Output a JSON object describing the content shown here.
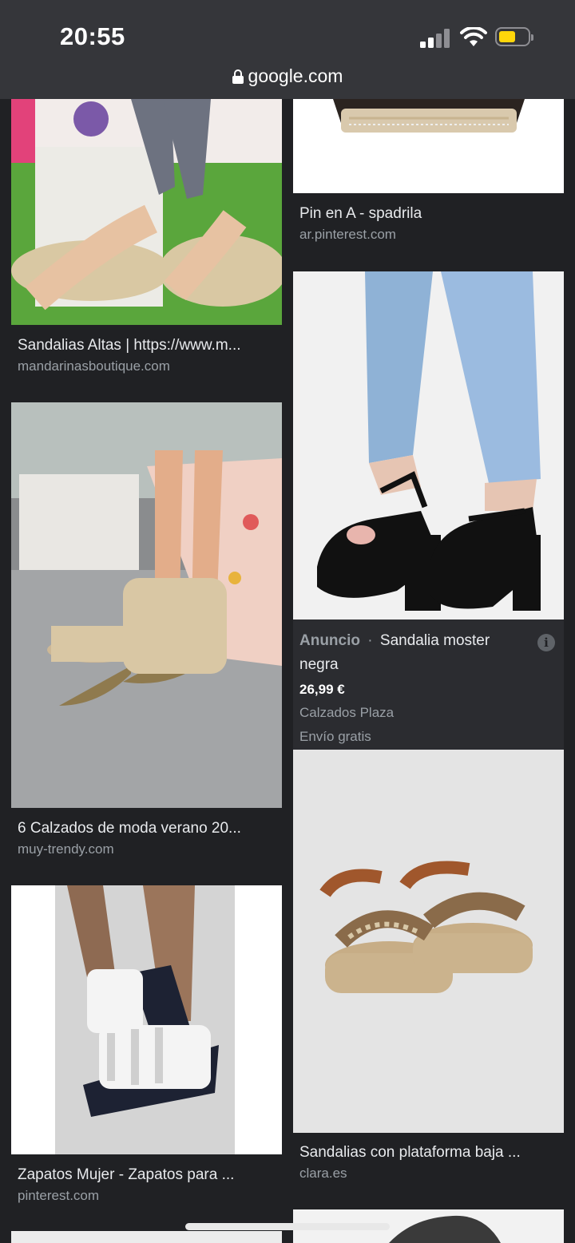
{
  "status_bar": {
    "time": "20:55"
  },
  "browser": {
    "url": "google.com"
  },
  "results": {
    "left": [
      {
        "title": "Sandalias Altas | https://www.m...",
        "source": "mandarinasboutique.com"
      },
      {
        "title": "6 Calzados de moda verano 20...",
        "source": "muy-trendy.com"
      },
      {
        "title": "Zapatos Mujer - Zapatos para ...",
        "source": "pinterest.com"
      }
    ],
    "right": [
      {
        "title": "Pin en A - spadrila",
        "source": "ar.pinterest.com"
      },
      {
        "ad_label": "Anuncio",
        "separator": "·",
        "title_line1": "Sandalia moster",
        "title_line2": "negra",
        "price": "26,99 €",
        "merchant": "Calzados Plaza",
        "shipping": "Envío gratis",
        "info_icon": "i"
      },
      {
        "title": "Sandalias con plataforma baja ...",
        "source": "clara.es"
      }
    ]
  },
  "colors": {
    "background": "#202124",
    "status_bar": "#35363a",
    "title_text": "#e8eaed",
    "source_text": "#9aa0a6",
    "battery": "#ffd60a"
  }
}
